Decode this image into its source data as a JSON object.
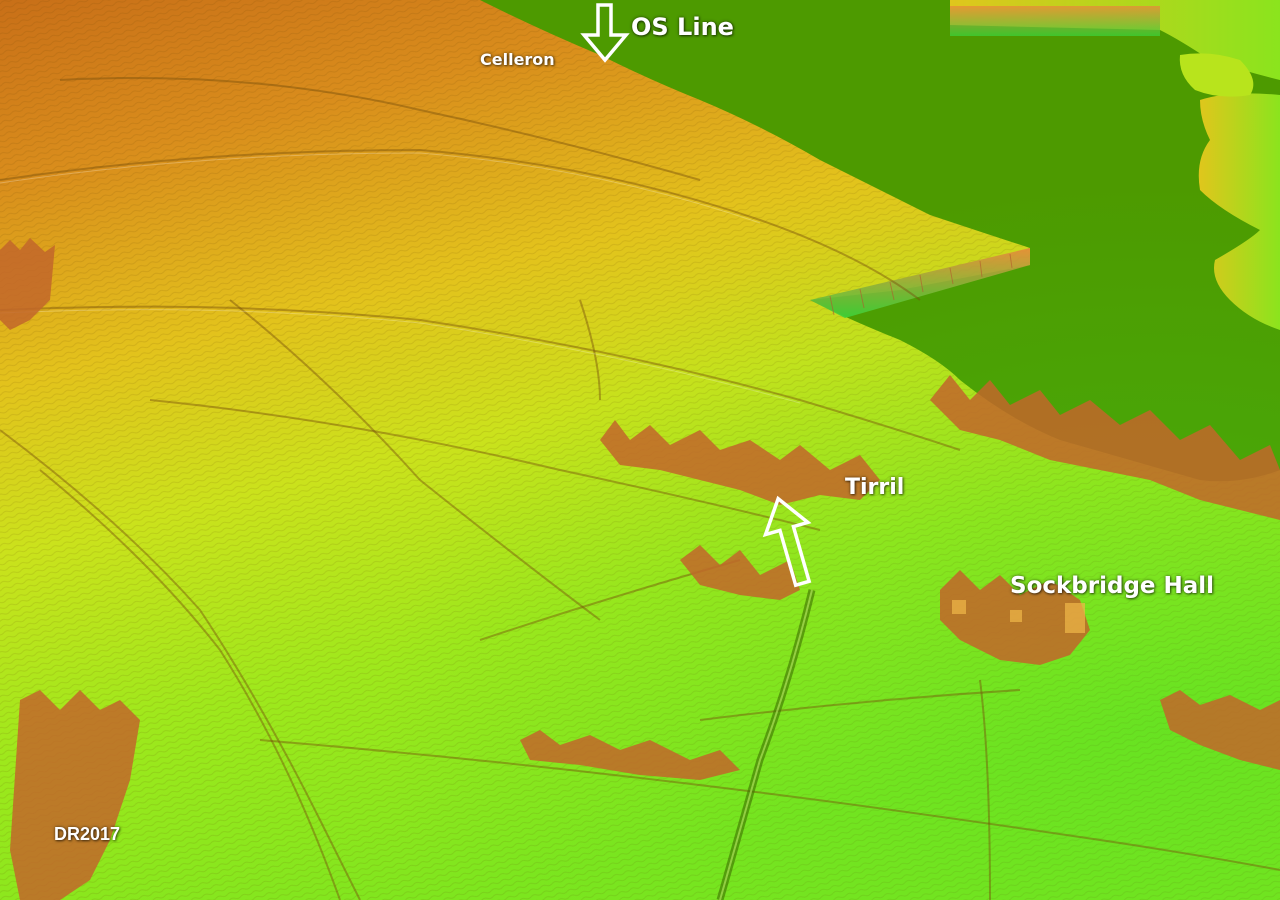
{
  "map": {
    "labels": {
      "os_line": "OS Line",
      "celleron": "Celleron",
      "tirril": "Tirril",
      "sockbridge_hall": "Sockbridge Hall"
    },
    "credit": "DR2017"
  },
  "colors": {
    "nodata_green": "#4d9a00",
    "ridge_orange": "#d67f1a",
    "field_yellow": "#e8d21a",
    "lowland_green": "#8fe81c",
    "arrow_outline": "#ffffff"
  },
  "icons": [
    "down-arrow-icon",
    "up-arrow-icon"
  ]
}
